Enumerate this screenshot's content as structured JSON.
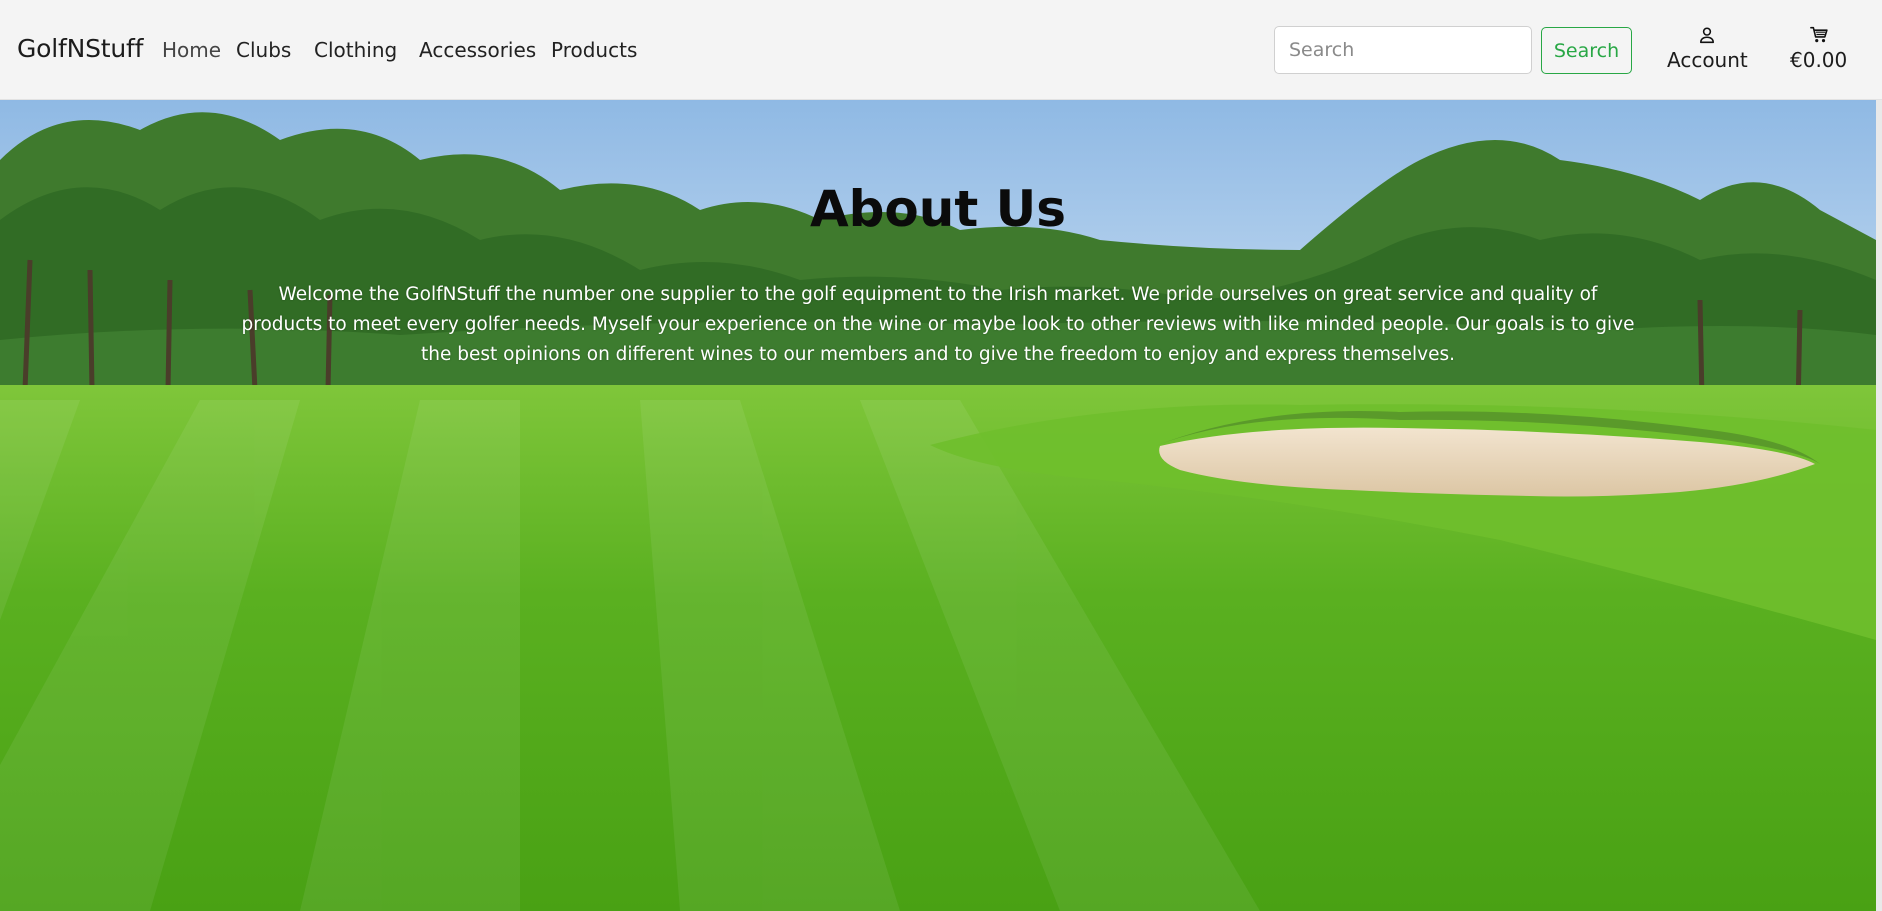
{
  "header": {
    "brand": "GolfNStuff",
    "nav": [
      {
        "label": "Home"
      },
      {
        "label": "Clubs"
      },
      {
        "label": "Clothing"
      },
      {
        "label": "Accessories"
      },
      {
        "label": "Products"
      }
    ],
    "search": {
      "placeholder": "Search",
      "value": "",
      "button_label": "Search"
    },
    "account": {
      "label": "Account",
      "icon": "person-icon"
    },
    "cart": {
      "label": "€0.00",
      "icon": "cart-icon"
    }
  },
  "hero": {
    "title": "About Us",
    "text": "Welcome the GolfNStuff the number one supplier to the golf equipment to the Irish market. We pride ourselves on great service and quality of products to meet every golfer needs. Myself your experience on the wine or maybe look to other reviews with like minded people. Our goals is to give the best opinions on different wines to our members and to give the freedom to enjoy and express themselves."
  },
  "colors": {
    "navbar_bg": "#f4f4f4",
    "accent_green": "#28a745",
    "hero_text": "#ffffff",
    "hero_title": "#0b0b0b"
  }
}
